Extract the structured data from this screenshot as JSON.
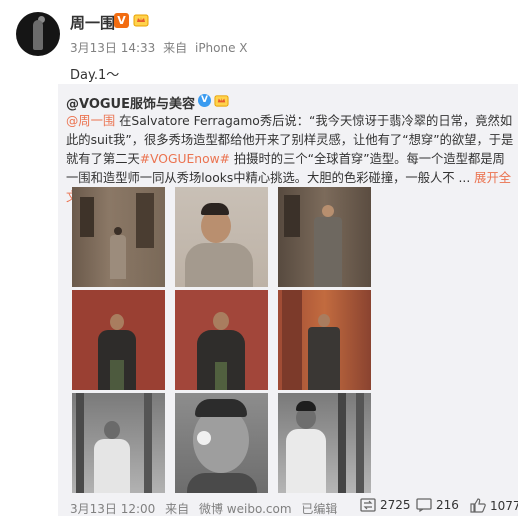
{
  "post": {
    "username": "周一围",
    "v_badge": "V",
    "date": "3月13日 14:33",
    "from_label": "来自",
    "source": "iPhone X",
    "text": "Day.1～"
  },
  "repost": {
    "author": "@VOGUE服饰与美容",
    "text_parts": {
      "mention": "@周一围",
      "p1": " 在Salvatore Ferragamo秀后说：“我今天惊讶于翡冷翠的日常，竟然如此的suit我”，很多秀场造型都给他开来了别样灵感，让他有了“想穿”的欲望，于是就有了第二天",
      "hashtag": "#VOGUEnow#",
      "p2": " 拍摄时的三个“全球首穿”造型。每一个造型都是周一围和造型师一同从秀场looks中精心挑选。大胆的色彩碰撞，一般人不 ...",
      "more": "展开全文"
    },
    "footer": {
      "date": "3月13日 12:00",
      "from_label": "来自",
      "source": "微博 weibo.com",
      "edited": "已编辑"
    },
    "actions": {
      "repost_count": "2725",
      "comment_count": "216",
      "like_count": "1077"
    }
  },
  "icons": [
    "v-badge-icon",
    "crown-icon",
    "repost-icon",
    "comment-icon",
    "like-icon",
    "chevron-down-icon"
  ],
  "colors": {
    "link": "#eb7350",
    "badge": "#f26c11",
    "repost_bg": "#f2f2f5"
  }
}
